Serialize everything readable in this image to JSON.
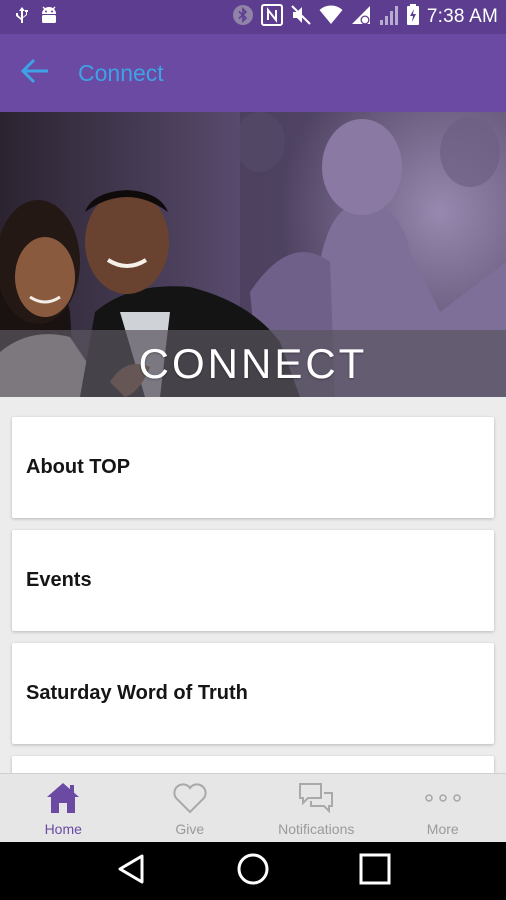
{
  "status_bar": {
    "time": "7:38 AM",
    "icons": [
      "usb-icon",
      "android-debug-icon",
      "bluetooth-icon",
      "nfc-icon",
      "mute-icon",
      "wifi-icon",
      "data-signal-icon",
      "signal-icon",
      "battery-charging-icon"
    ]
  },
  "app_bar": {
    "title": "Connect",
    "back_icon": "arrow-left-icon",
    "accent_color": "#3fa2e6",
    "background_color": "#6a4aa3"
  },
  "hero": {
    "title": "CONNECT"
  },
  "menu": {
    "items": [
      {
        "label": "About TOP"
      },
      {
        "label": "Events"
      },
      {
        "label": "Saturday Word of Truth"
      },
      {
        "label": ""
      }
    ]
  },
  "tab_bar": {
    "tabs": [
      {
        "label": "Home",
        "icon": "home-icon",
        "active": true
      },
      {
        "label": "Give",
        "icon": "heart-icon",
        "active": false
      },
      {
        "label": "Notifications",
        "icon": "chat-bubbles-icon",
        "active": false
      },
      {
        "label": "More",
        "icon": "more-dots-icon",
        "active": false
      }
    ],
    "active_color": "#6a4aa3",
    "inactive_color": "#9a9a9a"
  },
  "nav_bar": {
    "buttons": [
      "back-triangle-icon",
      "home-circle-icon",
      "recents-square-icon"
    ]
  }
}
